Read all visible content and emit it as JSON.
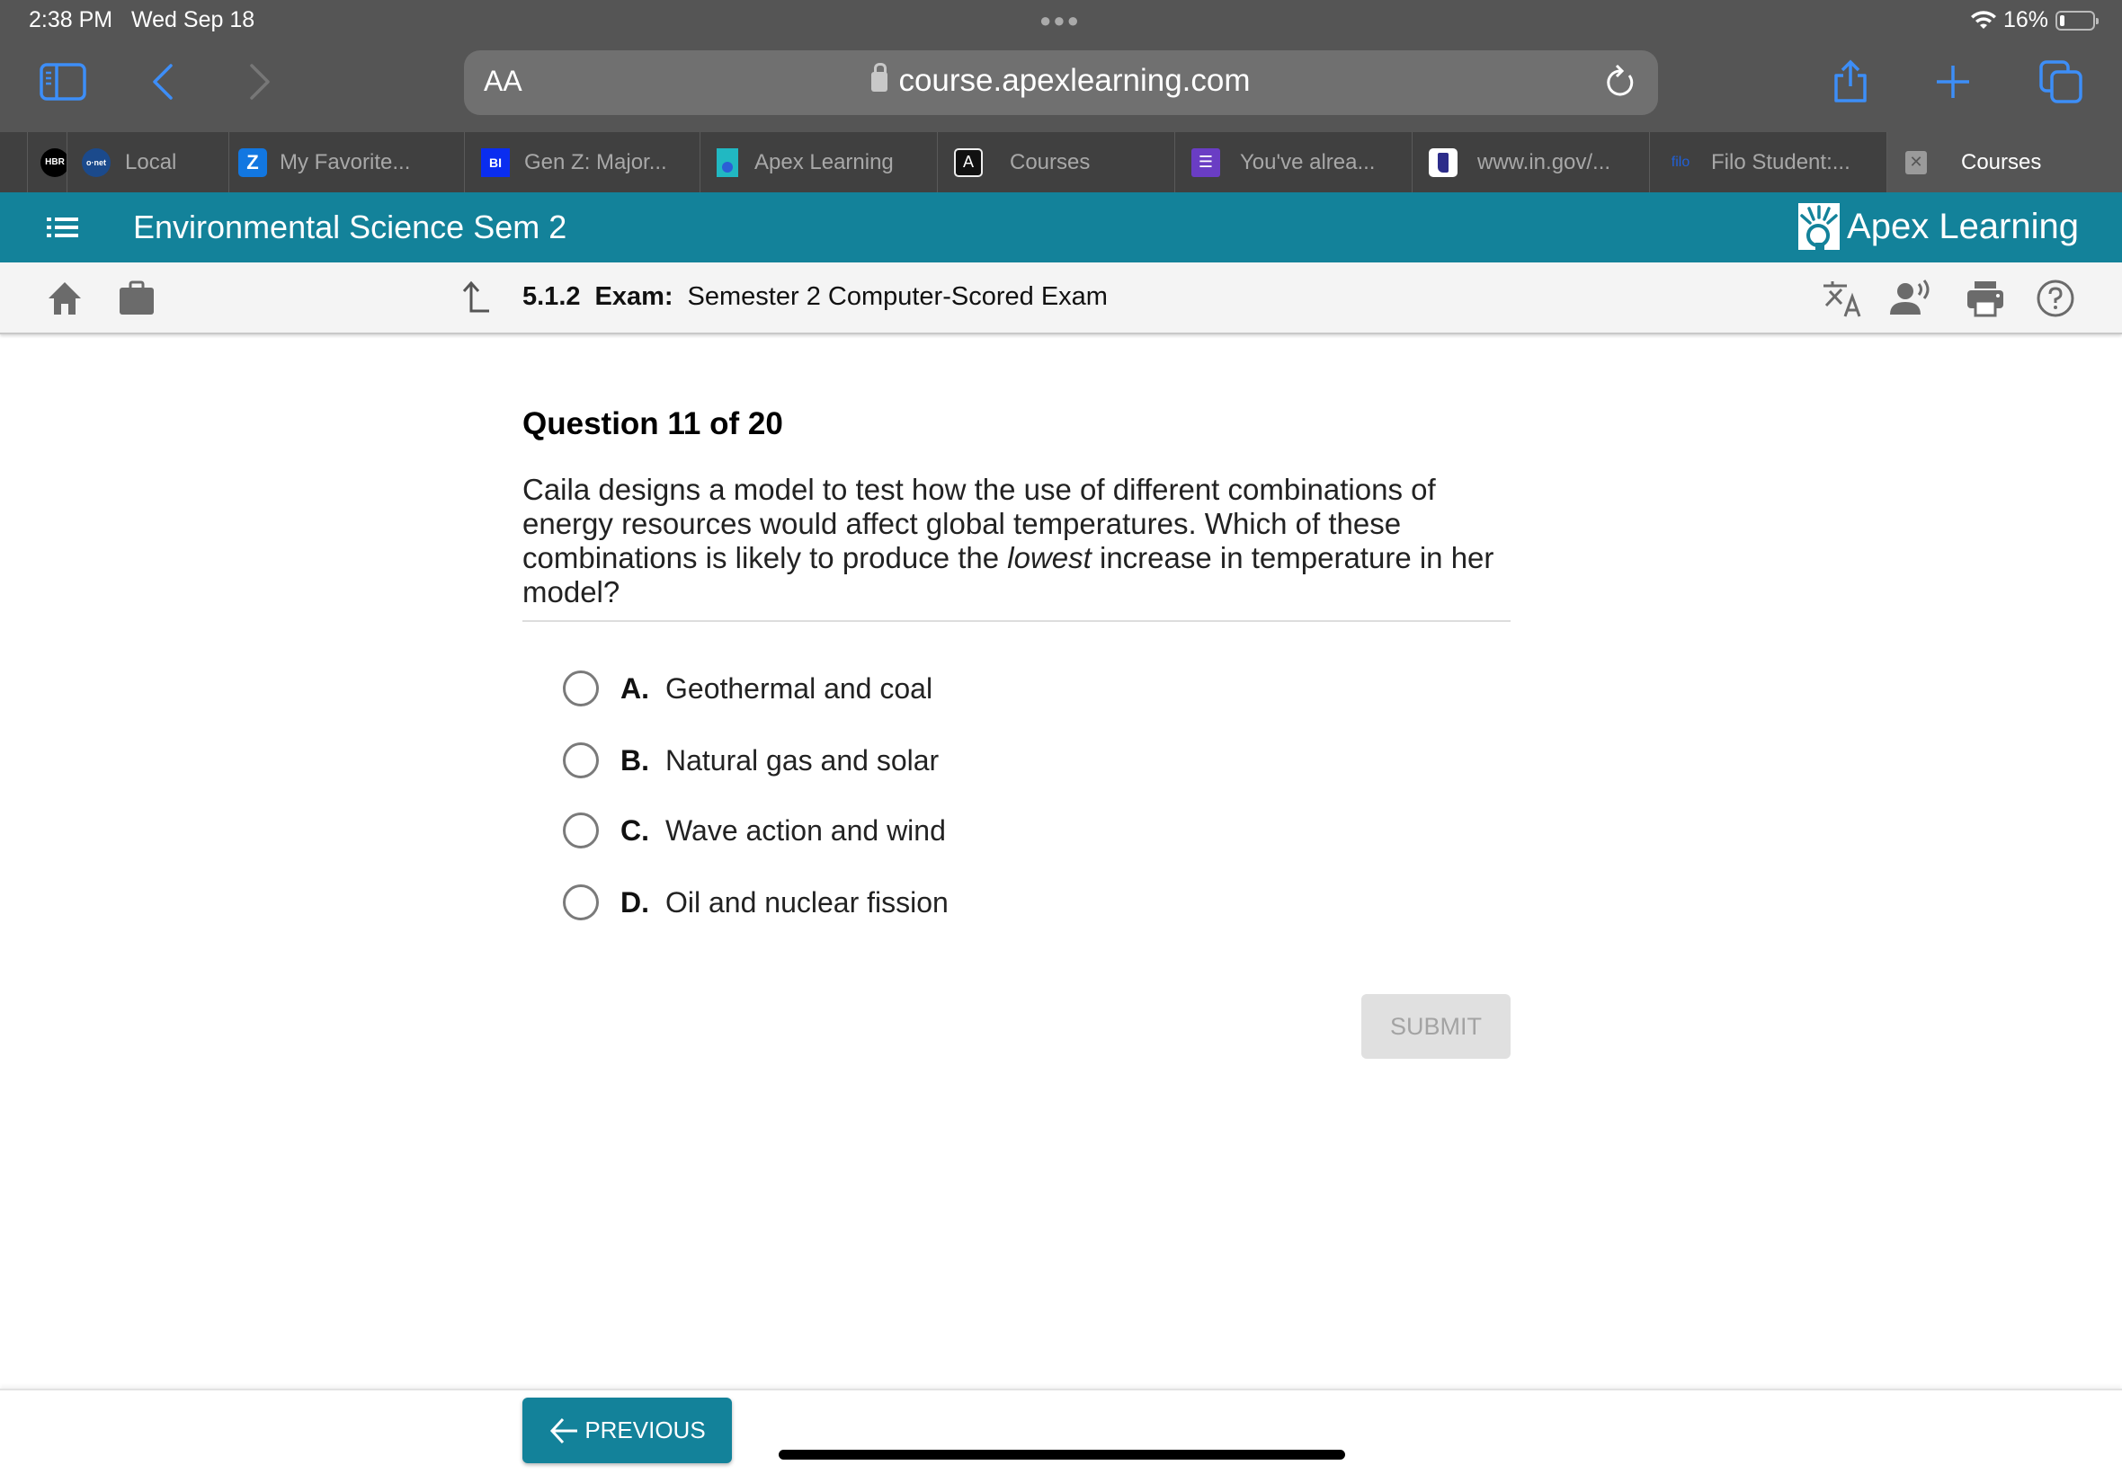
{
  "status_bar": {
    "time": "2:38 PM",
    "date": "Wed Sep 18",
    "battery": "16%"
  },
  "browser": {
    "text_size_label": "AA",
    "url": "course.apexlearning.com",
    "accent_color": "#3d8ef8",
    "tabs": [
      {
        "label": "",
        "favicon": "HBR",
        "favicon_bg": "#000000"
      },
      {
        "label": "Local",
        "favicon": "o·net",
        "favicon_bg": "#1b4a8c"
      },
      {
        "label": "My Favorite...",
        "favicon": "Z",
        "favicon_bg": "#1277e1"
      },
      {
        "label": "Gen Z: Major...",
        "favicon": "BI",
        "favicon_bg": "#0a2df0"
      },
      {
        "label": "Apex Learning",
        "favicon": "apex",
        "favicon_bg": "#21b8c2"
      },
      {
        "label": "Courses",
        "favicon": "A",
        "favicon_bg": "#111111"
      },
      {
        "label": "You've alrea...",
        "favicon": "list",
        "favicon_bg": "#6a3dc4"
      },
      {
        "label": "www.in.gov/...",
        "favicon": "IN",
        "favicon_bg": "#ffffff"
      },
      {
        "label": "Filo Student:...",
        "favicon": "filo",
        "favicon_bg": "transparent"
      },
      {
        "label": "Courses",
        "favicon": "close",
        "favicon_bg": "#9a9a9a",
        "active": true
      }
    ]
  },
  "header": {
    "course_title": "Environmental Science Sem 2",
    "brand": "Apex Learning",
    "brand_color": "#13829a"
  },
  "subnav": {
    "lesson_number": "5.1.2",
    "lesson_kind": "Exam:",
    "lesson_title": "Semester 2 Computer-Scored Exam"
  },
  "question": {
    "title": "Question 11 of 20",
    "text_before": "Caila designs a model to test how the use of different combinations of energy resources would affect global temperatures. Which of these combinations is likely to produce the ",
    "text_emphasis": "lowest",
    "text_after": " increase in temperature in her model?",
    "options": [
      {
        "letter": "A.",
        "text": "Geothermal and coal"
      },
      {
        "letter": "B.",
        "text": "Natural gas and solar"
      },
      {
        "letter": "C.",
        "text": "Wave action and wind"
      },
      {
        "letter": "D.",
        "text": "Oil and nuclear fission"
      }
    ],
    "submit_label": "SUBMIT"
  },
  "footer": {
    "previous_label": "PREVIOUS"
  }
}
